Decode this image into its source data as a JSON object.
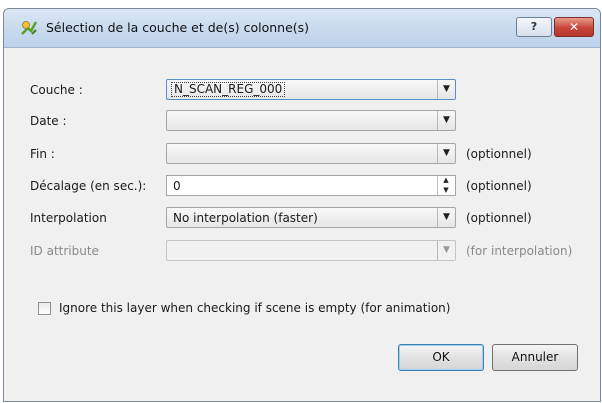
{
  "window": {
    "title": "Sélection de la couche et de(s) colonne(s)",
    "help_label": "?",
    "close_label": "✕"
  },
  "form": {
    "layer": {
      "label": "Couche :",
      "value": "N_SCAN_REG_000"
    },
    "date": {
      "label": "Date :",
      "value": ""
    },
    "end": {
      "label": "Fin :",
      "value": "",
      "note": "(optionnel)"
    },
    "offset": {
      "label": "Décalage (en sec.):",
      "value": "0",
      "note": "(optionnel)"
    },
    "interpolation": {
      "label": "Interpolation",
      "value": "No interpolation (faster)",
      "note": "(optionnel)"
    },
    "id_attribute": {
      "label": "ID attribute",
      "value": "",
      "note": "(for interpolation)"
    }
  },
  "ignore_checkbox": {
    "label": "Ignore this layer when checking if scene is empty (for animation)",
    "checked": false
  },
  "buttons": {
    "ok": "OK",
    "cancel": "Annuler"
  },
  "icons": {
    "app": "qgis-icon",
    "dropdown": "chevron-down-icon",
    "spin_up": "arrow-up-icon",
    "spin_down": "arrow-down-icon"
  },
  "colors": {
    "titlebar": "#c9dbee",
    "close": "#c8453a",
    "dialog": "#f0f0f0"
  }
}
